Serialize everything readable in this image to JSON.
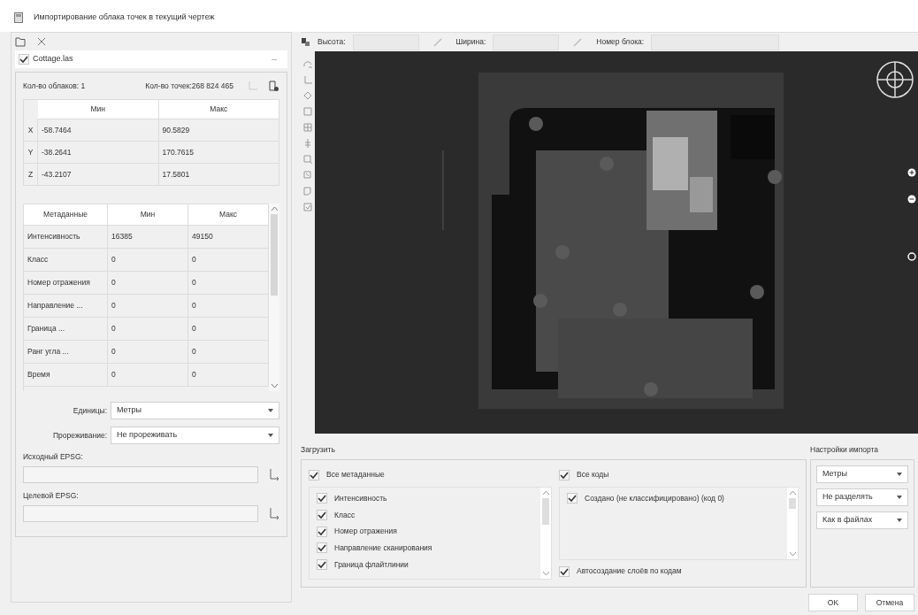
{
  "window": {
    "title": "Импортирование облака точек в текущий чертеж"
  },
  "left": {
    "file": {
      "name": "Cottage.las",
      "checked": true
    },
    "counts": [
      "Кол-во облаков: 1",
      "Кол-во точек:268 824 465"
    ],
    "coords": {
      "columns": [
        "Мин",
        "Макс"
      ],
      "rows": [
        {
          "axis": "X",
          "min": "-58.7464",
          "max": "90.5829"
        },
        {
          "axis": "Y",
          "min": "-38.2641",
          "max": "170.7615"
        },
        {
          "axis": "Z",
          "min": "-43.2107",
          "max": "17.5801"
        }
      ]
    },
    "metadata": {
      "columns": [
        "Метаданные",
        "Мин",
        "Макс"
      ],
      "rows": [
        {
          "name": "Интенсивность",
          "min": "16385",
          "max": "49150"
        },
        {
          "name": "Класс",
          "min": "0",
          "max": "0"
        },
        {
          "name": "Номер отражения",
          "min": "0",
          "max": "0"
        },
        {
          "name": "Направление ...",
          "min": "0",
          "max": "0"
        },
        {
          "name": "Граница ...",
          "min": "0",
          "max": "0"
        },
        {
          "name": "Ранг угла ...",
          "min": "0",
          "max": "0"
        },
        {
          "name": "Время",
          "min": "0",
          "max": "0"
        }
      ]
    },
    "units": {
      "label": "Единицы:",
      "value": "Метры"
    },
    "thinning": {
      "label": "Прореживание:",
      "value": "Не прореживать"
    },
    "epsg": [
      {
        "label": "Исходный EPSG:"
      },
      {
        "label": "Целевой EPSG:"
      }
    ]
  },
  "viewer": {
    "fields": [
      {
        "label": "Высота:"
      },
      {
        "label": "Ширина:"
      },
      {
        "label": "Номер блока:"
      }
    ]
  },
  "load": {
    "title": "Загрузить",
    "all_metadata": {
      "label": "Все метаданные",
      "checked": true
    },
    "metadata_items": [
      {
        "label": "Интенсивность",
        "checked": true
      },
      {
        "label": "Класс",
        "checked": true
      },
      {
        "label": "Номер отражения",
        "checked": true
      },
      {
        "label": "Направление сканирования",
        "checked": true
      },
      {
        "label": "Граница флайтлинии",
        "checked": true
      }
    ],
    "all_codes": {
      "label": "Все коды",
      "checked": true
    },
    "codes": [
      {
        "label": "Создано (не классифицировано) (код 0)",
        "checked": true
      }
    ],
    "auto_layers": {
      "label": "Автосоздание слоёв по кодам",
      "checked": true
    }
  },
  "settings": {
    "title": "Настройки импорта",
    "selects": [
      "Метры",
      "Не разделять",
      "Как в файлах"
    ]
  },
  "buttons": [
    "OK",
    "Отмена"
  ]
}
